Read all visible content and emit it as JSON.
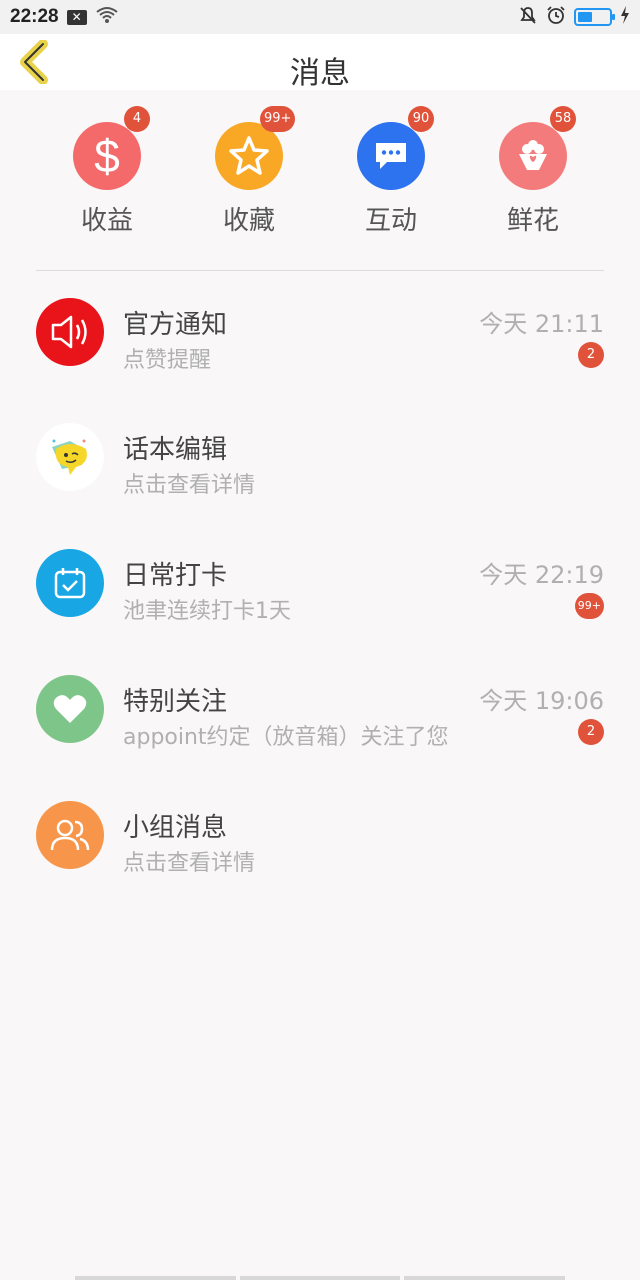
{
  "status_bar": {
    "time": "22:28",
    "icons": [
      "close-box-icon",
      "wifi-icon",
      "bell-muted-icon",
      "alarm-icon",
      "battery-icon",
      "charging-icon"
    ],
    "battery_level": 0.4
  },
  "header": {
    "title": "消息",
    "back_icon": "chevron-left-icon"
  },
  "categories": [
    {
      "label": "收益",
      "badge": "4",
      "icon": "dollar-icon",
      "color": "#f46a6a"
    },
    {
      "label": "收藏",
      "badge": "99+",
      "icon": "star-icon",
      "color": "#f9a826"
    },
    {
      "label": "互动",
      "badge": "90",
      "icon": "chat-bubble-icon",
      "color": "#2d73f0"
    },
    {
      "label": "鲜花",
      "badge": "58",
      "icon": "flower-bouquet-icon",
      "color": "#f47b7b"
    }
  ],
  "messages": [
    {
      "title": "官方通知",
      "subtitle": "点赞提醒",
      "time": "今天 21:11",
      "badge": "2",
      "icon": "speaker-icon",
      "color": "#e8141a"
    },
    {
      "title": "话本编辑",
      "subtitle": "点击查看详情",
      "time": "",
      "badge": "",
      "icon": "editor-avatar-icon",
      "color": "#ffffff"
    },
    {
      "title": "日常打卡",
      "subtitle": "池聿连续打卡1天",
      "time": "今天 22:19",
      "badge": "99+",
      "icon": "calendar-check-icon",
      "color": "#18a7e4"
    },
    {
      "title": "特别关注",
      "subtitle": "appoint约定（放音箱）关注了您",
      "time": "今天 19:06",
      "badge": "2",
      "icon": "heart-icon",
      "color": "#7ec58a"
    },
    {
      "title": "小组消息",
      "subtitle": "点击查看详情",
      "time": "",
      "badge": "",
      "icon": "group-users-icon",
      "color": "#f7964a"
    }
  ]
}
